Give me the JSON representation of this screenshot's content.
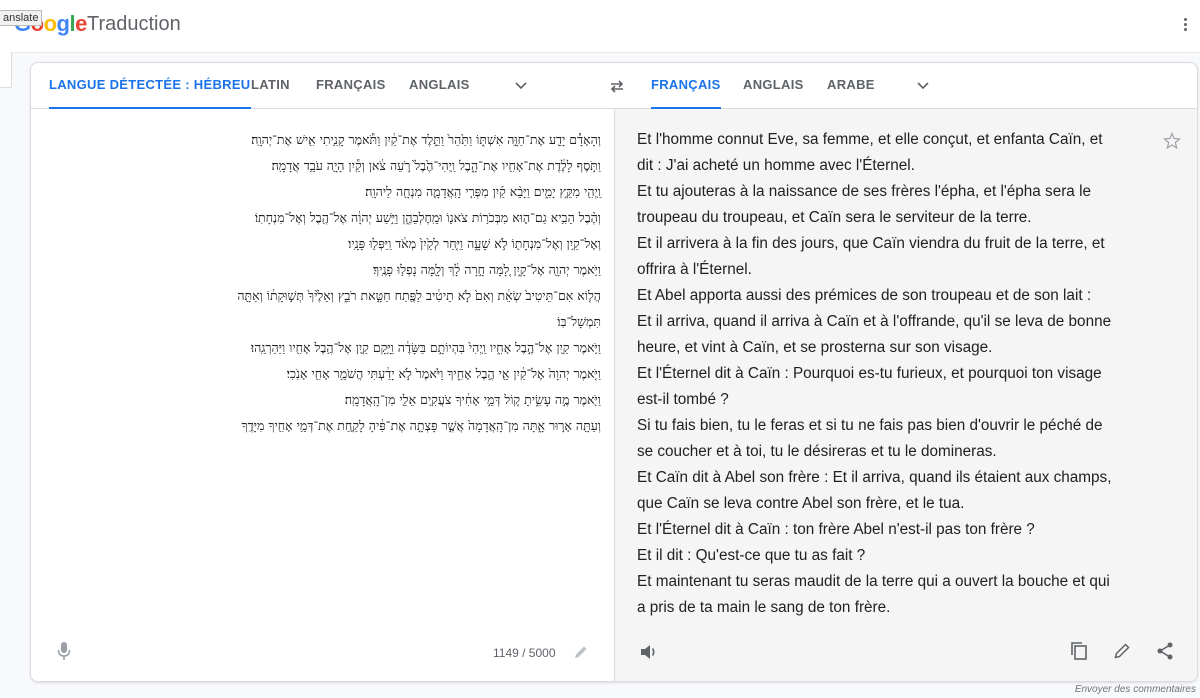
{
  "header": {
    "tooltip": "anslate",
    "logo": [
      "G",
      "o",
      "o",
      "g",
      "l",
      "e"
    ],
    "app_name": "Traduction"
  },
  "source_langs": {
    "detected": "LANGUE DÉTECTÉE : HÉBREU",
    "tabs": [
      "LATIN",
      "FRANÇAIS",
      "ANGLAIS"
    ]
  },
  "target_langs": {
    "tabs": [
      "FRANÇAIS",
      "ANGLAIS",
      "ARABE"
    ]
  },
  "source": {
    "lines": [
      "וְהָאָדָ֕ם יָדַ֖ע אֶת־חַוָּ֣ה אִשְׁתּ֑וֹ וַתַּ֙הַר֙ וַתֵּ֣לֶד אֶת־קַ֔יִן וַתֹּ֕אמֶר קָנִ֥יתִי אִ֖ישׁ אֶת־יְהוָֽה׃",
      "וַתֹּ֣סֶף לָלֶ֔דֶת אֶת־אָחִ֖יו אֶת־הָ֑בֶל וַֽיְהִי־הֶ֙בֶל֙ רֹ֣עֵה צֹ֔אן וְקַ֕יִן הָיָ֖ה עֹבֵ֥ד אֲדָמָֽה׃",
      "וַֽיְהִ֖י מִקֵּ֣ץ יָמִ֑ים וַיָּבֵ֨א קַ֜יִן מִפְּרִ֧י הָֽאֲדָמָ֛ה מִנְחָ֖ה לַיהוָֽה׃",
      "וְהֶ֨בֶל הֵבִ֥יא גַם־ה֛וּא מִבְּכֹר֥וֹת צֹאנ֖וֹ וּמֵֽחֶלְבֵהֶ֑ן וַיִּ֣שַׁע יְהוָ֔ה אֶל־הֶ֖בֶל וְאֶל־מִנְחָתֽוֹ׃",
      "וְאֶל־קַ֥יִן וְאֶל־מִנְחָת֖וֹ לֹ֣א שָׁעָ֑ה וַיִּ֤חַר לְקַ֙יִן֙ מְאֹ֔ד וַֽיִּפְּל֖וּ פָּנָֽיו׃",
      "וַיֹּ֥אמֶר יְהוָ֖ה אֶל־קָ֑יִן לָ֚מָּה חָ֣רָה לָ֔ךְ וְלָ֖מָּה נָפְל֥וּ פָנֶֽיךָ׃",
      "הֲל֤וֹא אִם־תֵּיטִיב֙ שְׂאֵ֔ת וְאִם֙ לֹ֣א תֵיטִ֔יב לַפֶּ֖תַח חַטָּ֣את רֹבֵ֑ץ וְאֵלֶ֙יךָ֙ תְּשׁ֣וּקָת֔וֹ וְאַתָּ֖ה",
      "תִּמְשָׁל־בּֽוֹ׃",
      "וַיֹּ֥אמֶר קַ֖יִן אֶל־הֶ֣בֶל אָחִ֑יו וַֽיְהִי֙ בִּהְיוֹתָ֣ם בַּשָּׂדֶ֔ה וַיָּ֥קָם קַ֛יִן אֶל־הֶ֥בֶל אָחִ֖יו וַיַּהַרְגֵֽהוּ׃",
      "וַיֹּ֤אמֶר יְהוָה֙ אֶל־קַ֔יִן אֵ֖י הֶ֣בֶל אָחִ֑יךָ וַיֹּ֙אמֶר֙ לֹ֣א יָדַ֔עְתִּי הֲשֹׁמֵ֥ר אָחִ֖י אָנֹֽכִי׃",
      "וַיֹּ֖אמֶר מֶ֣ה עָשִׂ֑יתָ ק֚וֹל דְּמֵ֣י אָחִ֔יךָ צֹעֲקִ֥ים אֵלַ֖י מִן־הָֽאֲדָמָֽה׃",
      "וְעַתָּ֖ה אָר֣וּר אָ֑תָּה מִן־הָֽאֲדָמָה֙ אֲשֶׁ֣ר פָּצְתָ֣ה אֶת־פִּ֔יהָ לָקַ֛חַת אֶת־דְּמֵ֥י אָחִ֖יךָ מִיָּדֶֽךָ"
    ],
    "counter": "1149 / 5000"
  },
  "target": {
    "lines": [
      "Et l'homme connut Eve, sa femme, et elle conçut, et enfanta Caïn, et",
      "dit : J'ai acheté un homme avec l'Éternel.",
      "Et tu ajouteras à la naissance de ses frères l'épha, et l'épha sera le",
      "troupeau du troupeau, et Caïn sera le serviteur de la terre.",
      "Et il arrivera à la fin des jours, que Caïn viendra du fruit de la terre, et",
      "offrira à l'Éternel.",
      "Et Abel apporta aussi des prémices de son troupeau et de son lait :",
      "Et il arriva, quand il arriva à Caïn et à l'offrande, qu'il se leva de bonne",
      "heure, et vint à Caïn, et se prosterna sur son visage.",
      "Et l'Éternel dit à Caïn : Pourquoi es-tu furieux, et pourquoi ton visage",
      "est-il tombé ?",
      "Si tu fais bien, tu le feras et si tu ne fais pas bien d'ouvrir le péché de",
      "se coucher et à toi, tu le désireras et tu le domineras.",
      "Et Caïn dit à Abel son frère : Et il arriva, quand ils étaient aux champs,",
      "que Caïn se leva contre Abel son frère, et le tua.",
      "Et l'Éternel dit à Caïn : ton frère Abel n'est-il pas ton frère ?",
      "Et il dit : Qu'est-ce que tu as fait ?",
      "Et maintenant tu seras maudit de la terre qui a ouvert la bouche et qui",
      "a pris de ta main le sang de ton frère."
    ]
  },
  "footer": {
    "feedback": "Envoyer des commentaires"
  },
  "colors": {
    "accent": "#1a73e8",
    "text": "#202124",
    "muted": "#5f6368",
    "target_bg": "#f5f5f5"
  },
  "icons": [
    "apps-icon",
    "chevron-down-icon",
    "swap-icon",
    "star-icon",
    "mic-icon",
    "pencil-icon",
    "speaker-icon",
    "copy-icon",
    "share-icon"
  ]
}
